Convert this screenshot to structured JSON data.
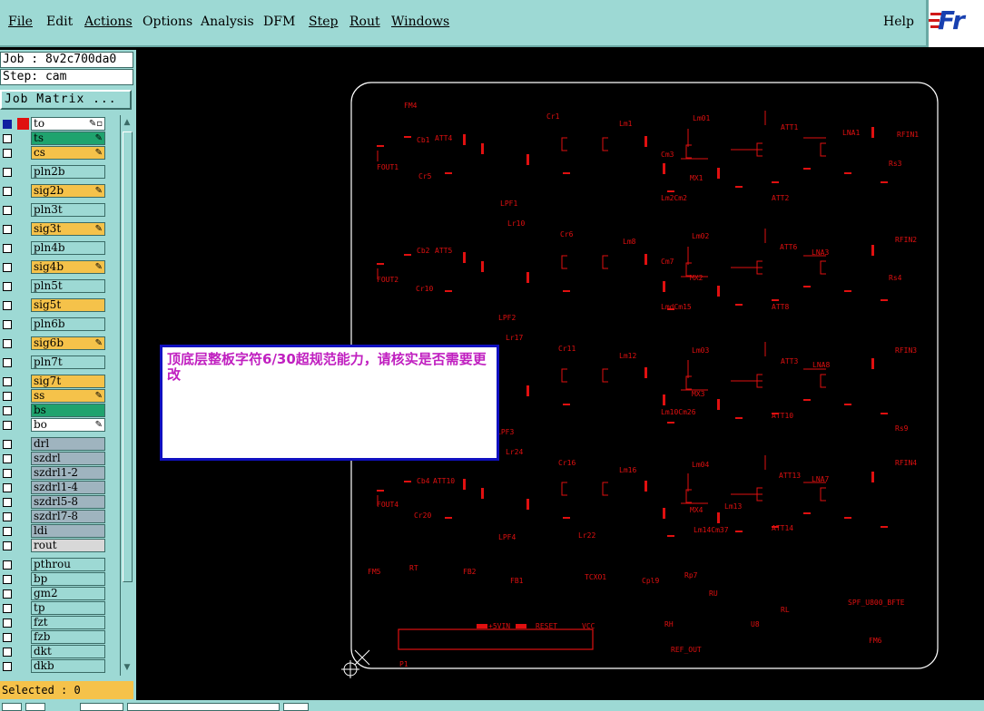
{
  "menu": {
    "items": [
      "File",
      "Edit",
      "Actions",
      "Options",
      "Analysis",
      "DFM",
      "Step",
      "Rout",
      "Windows"
    ],
    "help": "Help",
    "logo": "Fr"
  },
  "job": {
    "job_label": "Job : 8v2c700da0",
    "step_label": "Step: cam",
    "matrix_button": "Job Matrix ..."
  },
  "layers": [
    {
      "name": "to",
      "color": "#ffffff",
      "chip": "#e01010",
      "checked": true,
      "mark": "✎▫"
    },
    {
      "name": "ts",
      "color": "#1fa36e",
      "chip": "",
      "checked": false,
      "mark": "✎"
    },
    {
      "name": "cs",
      "color": "#f5c24a",
      "chip": "",
      "checked": false,
      "mark": "✎"
    },
    {
      "name": "pln2b",
      "color": "#9dd9d4",
      "chip": "",
      "checked": false,
      "mark": ""
    },
    {
      "name": "sig2b",
      "color": "#f5c24a",
      "chip": "",
      "checked": false,
      "mark": "✎"
    },
    {
      "name": "pln3t",
      "color": "#9dd9d4",
      "chip": "",
      "checked": false,
      "mark": ""
    },
    {
      "name": "sig3t",
      "color": "#f5c24a",
      "chip": "",
      "checked": false,
      "mark": "✎"
    },
    {
      "name": "pln4b",
      "color": "#9dd9d4",
      "chip": "",
      "checked": false,
      "mark": ""
    },
    {
      "name": "sig4b",
      "color": "#f5c24a",
      "chip": "",
      "checked": false,
      "mark": "✎"
    },
    {
      "name": "pln5t",
      "color": "#9dd9d4",
      "chip": "",
      "checked": false,
      "mark": ""
    },
    {
      "name": "sig5t",
      "color": "#f5c24a",
      "chip": "",
      "checked": false,
      "mark": ""
    },
    {
      "name": "pln6b",
      "color": "#9dd9d4",
      "chip": "",
      "checked": false,
      "mark": ""
    },
    {
      "name": "sig6b",
      "color": "#f5c24a",
      "chip": "",
      "checked": false,
      "mark": "✎"
    },
    {
      "name": "pln7t",
      "color": "#9dd9d4",
      "chip": "",
      "checked": false,
      "mark": ""
    },
    {
      "name": "sig7t",
      "color": "#f5c24a",
      "chip": "",
      "checked": false,
      "mark": ""
    },
    {
      "name": "ss",
      "color": "#f5c24a",
      "chip": "",
      "checked": false,
      "mark": "✎"
    },
    {
      "name": "bs",
      "color": "#1fa36e",
      "chip": "",
      "checked": false,
      "mark": ""
    },
    {
      "name": "bo",
      "color": "#ffffff",
      "chip": "",
      "checked": false,
      "mark": "✎"
    },
    {
      "name": "drl",
      "color": "#9fb4bf",
      "chip": "",
      "checked": false,
      "mark": ""
    },
    {
      "name": "szdrl",
      "color": "#9fb4bf",
      "chip": "",
      "checked": false,
      "mark": ""
    },
    {
      "name": "szdrl1-2",
      "color": "#9fb4bf",
      "chip": "",
      "checked": false,
      "mark": ""
    },
    {
      "name": "szdrl1-4",
      "color": "#9fb4bf",
      "chip": "",
      "checked": false,
      "mark": ""
    },
    {
      "name": "szdrl5-8",
      "color": "#9fb4bf",
      "chip": "",
      "checked": false,
      "mark": ""
    },
    {
      "name": "szdrl7-8",
      "color": "#9fb4bf",
      "chip": "",
      "checked": false,
      "mark": ""
    },
    {
      "name": "ldi",
      "color": "#9fb4bf",
      "chip": "",
      "checked": false,
      "mark": ""
    },
    {
      "name": "rout",
      "color": "#d8d8d8",
      "chip": "",
      "checked": false,
      "mark": ""
    },
    {
      "name": "pthrou",
      "color": "#9dd9d4",
      "chip": "",
      "checked": false,
      "mark": ""
    },
    {
      "name": "bp",
      "color": "#9dd9d4",
      "chip": "",
      "checked": false,
      "mark": ""
    },
    {
      "name": "gm2",
      "color": "#9dd9d4",
      "chip": "",
      "checked": false,
      "mark": ""
    },
    {
      "name": "tp",
      "color": "#9dd9d4",
      "chip": "",
      "checked": false,
      "mark": ""
    },
    {
      "name": "fzt",
      "color": "#9dd9d4",
      "chip": "",
      "checked": false,
      "mark": ""
    },
    {
      "name": "fzb",
      "color": "#9dd9d4",
      "chip": "",
      "checked": false,
      "mark": ""
    },
    {
      "name": "dkt",
      "color": "#9dd9d4",
      "chip": "",
      "checked": false,
      "mark": ""
    },
    {
      "name": "dkb",
      "color": "#9dd9d4",
      "chip": "",
      "checked": false,
      "mark": ""
    }
  ],
  "status": {
    "selected": "Selected : 0"
  },
  "dialog": {
    "message": "顶底层整板字符6/30超规范能力，请核实是否需要更改"
  },
  "board": {
    "trace_color": "#e01010",
    "outline_color": "#ffffff",
    "labels": [
      {
        "t": "FM4",
        "row": 0
      },
      {
        "t": "Cr1",
        "row": 0
      },
      {
        "t": "Lm1",
        "row": 0
      },
      {
        "t": "Lm01",
        "row": 0
      },
      {
        "t": "ATT1",
        "row": 0
      },
      {
        "t": "LNA1",
        "row": 0
      },
      {
        "t": "RFIN1",
        "row": 0
      },
      {
        "t": "Cb1",
        "row": 0
      },
      {
        "t": "ATT4",
        "row": 0
      },
      {
        "t": "FOUT1",
        "row": 0
      },
      {
        "t": "Cr5",
        "row": 0
      },
      {
        "t": "Cm3",
        "row": 0
      },
      {
        "t": "MX1",
        "row": 0
      },
      {
        "t": "Rs3",
        "row": 0
      },
      {
        "t": "LPF1",
        "row": 0
      },
      {
        "t": "Lm2Cm2",
        "row": 0
      },
      {
        "t": "ATT2",
        "row": 0
      },
      {
        "t": "Lr10",
        "row": 1
      },
      {
        "t": "Cr6",
        "row": 1
      },
      {
        "t": "Lm8",
        "row": 1
      },
      {
        "t": "Lm02",
        "row": 1
      },
      {
        "t": "ATT6",
        "row": 1
      },
      {
        "t": "LNA3",
        "row": 1
      },
      {
        "t": "RFIN2",
        "row": 1
      },
      {
        "t": "Cb2",
        "row": 1
      },
      {
        "t": "ATT5",
        "row": 1
      },
      {
        "t": "FOUT2",
        "row": 1
      },
      {
        "t": "Cr10",
        "row": 1
      },
      {
        "t": "Cm7",
        "row": 1
      },
      {
        "t": "MX2",
        "row": 1
      },
      {
        "t": "Rs4",
        "row": 1
      },
      {
        "t": "LPF2",
        "row": 1
      },
      {
        "t": "LmdCm15",
        "row": 1
      },
      {
        "t": "ATT8",
        "row": 1
      },
      {
        "t": "Lr17",
        "row": 2
      },
      {
        "t": "Cr11",
        "row": 2
      },
      {
        "t": "Lm12",
        "row": 2
      },
      {
        "t": "Lm03",
        "row": 2
      },
      {
        "t": "ATT3",
        "row": 2
      },
      {
        "t": "LNA8",
        "row": 2
      },
      {
        "t": "RFIN3",
        "row": 2
      },
      {
        "t": "MX3",
        "row": 2
      },
      {
        "t": "LPF3",
        "row": 2
      },
      {
        "t": "Lm10Cm26",
        "row": 2
      },
      {
        "t": "ATT10",
        "row": 2
      },
      {
        "t": "Rs9",
        "row": 2
      },
      {
        "t": "Lr24",
        "row": 3
      },
      {
        "t": "Cr16",
        "row": 3
      },
      {
        "t": "Lm16",
        "row": 3
      },
      {
        "t": "Lm04",
        "row": 3
      },
      {
        "t": "ATT13",
        "row": 3
      },
      {
        "t": "LNA7",
        "row": 3
      },
      {
        "t": "RFIN4",
        "row": 3
      },
      {
        "t": "Cb4",
        "row": 3
      },
      {
        "t": "ATT10",
        "row": 3
      },
      {
        "t": "FOUT4",
        "row": 3
      },
      {
        "t": "Cr20",
        "row": 3
      },
      {
        "t": "MX4",
        "row": 3
      },
      {
        "t": "Lm13",
        "row": 3
      },
      {
        "t": "LPF4",
        "row": 3
      },
      {
        "t": "Lm14Cm37",
        "row": 3
      },
      {
        "t": "ATT14",
        "row": 3
      },
      {
        "t": "Lr22",
        "row": 3
      },
      {
        "t": "FM5",
        "row": 4
      },
      {
        "t": "RT",
        "row": 4
      },
      {
        "t": "FB2",
        "row": 4
      },
      {
        "t": "FB1",
        "row": 4
      },
      {
        "t": "TCXO1",
        "row": 4
      },
      {
        "t": "Cpl9",
        "row": 4
      },
      {
        "t": "Rp7",
        "row": 4
      },
      {
        "t": "RU",
        "row": 4
      },
      {
        "t": "RL",
        "row": 4
      },
      {
        "t": "SPF_U800_BFTE",
        "row": 4
      },
      {
        "t": "+5VIN",
        "row": 4
      },
      {
        "t": "RESET",
        "row": 4
      },
      {
        "t": "VCC",
        "row": 4
      },
      {
        "t": "RH",
        "row": 4
      },
      {
        "t": "U8",
        "row": 4
      },
      {
        "t": "REF_OUT",
        "row": 4
      },
      {
        "t": "FM6",
        "row": 4
      },
      {
        "t": "P1",
        "row": 4
      }
    ]
  }
}
